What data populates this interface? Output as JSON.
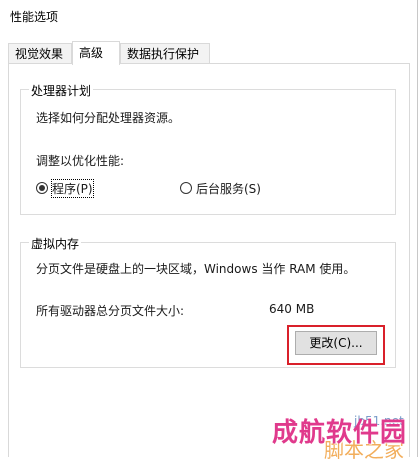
{
  "window": {
    "title": "性能选项"
  },
  "tabs": [
    {
      "label": "视觉效果",
      "active": false
    },
    {
      "label": "高级",
      "active": true
    },
    {
      "label": "数据执行保护",
      "active": false
    }
  ],
  "processor_scheduling": {
    "legend": "处理器计划",
    "description": "选择如何分配处理器资源。",
    "adjust_label": "调整以优化性能:",
    "options": [
      {
        "label": "程序(P)",
        "selected": true
      },
      {
        "label": "后台服务(S)",
        "selected": false
      }
    ]
  },
  "virtual_memory": {
    "legend": "虚拟内存",
    "description": "分页文件是硬盘上的一块区域，Windows 当作 RAM 使用。",
    "total_label": "所有驱动器总分页文件大小:",
    "total_value": "640 MB",
    "change_button": "更改(C)...",
    "highlight_color": "#d9202a"
  },
  "watermark": {
    "text_cn": "成航软件园",
    "text_small": "jb51.net",
    "text_site": "脚本之家"
  }
}
